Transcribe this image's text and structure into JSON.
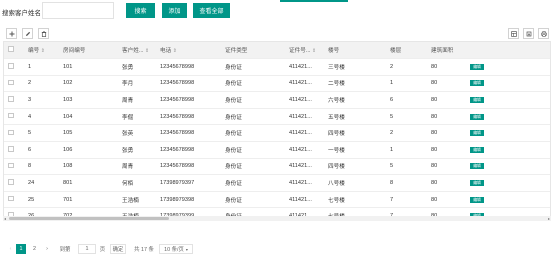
{
  "search": {
    "label": "搜索客户姓名：",
    "value": "",
    "placeholder": "",
    "search_button": "搜索",
    "add_button": "添加",
    "view_all_button": "查看全部"
  },
  "toolbar": {
    "add_icon": "plus-icon",
    "edit_icon": "pencil-icon",
    "delete_icon": "trash-icon",
    "columns_icon": "columns-icon",
    "export_icon": "export-icon",
    "print_icon": "print-icon"
  },
  "table": {
    "columns": [
      "编号",
      "房间编号",
      "客户姓...",
      "电话",
      "证件类型",
      "证件号...",
      "楼号",
      "楼层",
      "建筑面积",
      ""
    ],
    "sort_arrow": "⇕",
    "action_label": "编辑",
    "rows": [
      [
        "1",
        "101",
        "张勇",
        "12345678998",
        "身份证",
        "411421...",
        "三号楼",
        "2",
        "80"
      ],
      [
        "2",
        "102",
        "李月",
        "12345678998",
        "身份证",
        "411421...",
        "二号楼",
        "1",
        "80"
      ],
      [
        "3",
        "103",
        "周青",
        "12345678998",
        "身份证",
        "411421...",
        "六号楼",
        "6",
        "80"
      ],
      [
        "4",
        "104",
        "李倔",
        "12345678998",
        "身份证",
        "411421...",
        "五号楼",
        "5",
        "80"
      ],
      [
        "5",
        "105",
        "张英",
        "12345678998",
        "身份证",
        "411421...",
        "四号楼",
        "2",
        "80"
      ],
      [
        "6",
        "106",
        "张勇",
        "12345678998",
        "身份证",
        "411421...",
        "一号楼",
        "1",
        "80"
      ],
      [
        "8",
        "108",
        "周青",
        "12345678998",
        "身份证",
        "411421...",
        "四号楼",
        "5",
        "80"
      ],
      [
        "24",
        "801",
        "何栢",
        "17398979397",
        "身份证",
        "411421...",
        "八号楼",
        "8",
        "80"
      ],
      [
        "25",
        "701",
        "王浩楠",
        "17398979398",
        "身份证",
        "411421...",
        "七号楼",
        "7",
        "80"
      ],
      [
        "26",
        "702",
        "王浩楠",
        "17398979399",
        "身份证",
        "411421...",
        "七号楼",
        "7",
        "80"
      ]
    ]
  },
  "pagination": {
    "prev": "‹",
    "page1": "1",
    "page2": "2",
    "next": "›",
    "goto_label": "到第",
    "goto_value": "1",
    "page_suffix": "页",
    "confirm": "确定",
    "total": "共 17 条",
    "per_page": "10 条/页",
    "per_page_arrow": "▾"
  },
  "colors": {
    "accent": "#009688",
    "header_bg": "#f2f2f2"
  }
}
